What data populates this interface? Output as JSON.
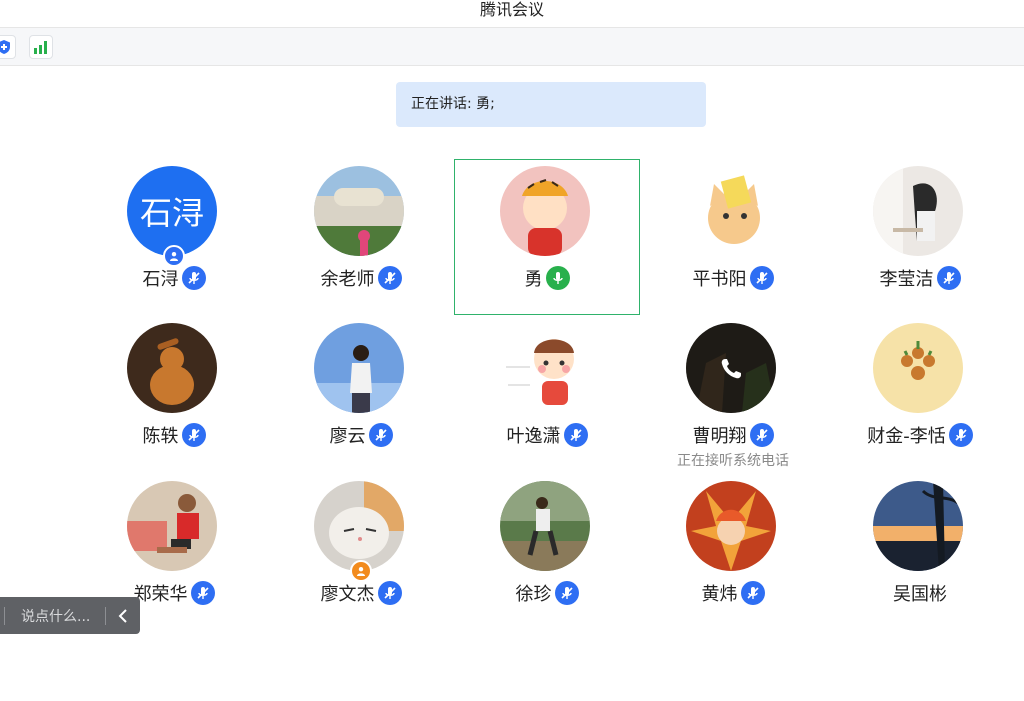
{
  "window": {
    "title": "腾讯会议"
  },
  "toolbar": {
    "security_icon": "shield-plus-icon",
    "network_icon": "signal-bars-icon",
    "accent": "#2e6ef3",
    "signal_color": "#28b04c"
  },
  "speaking_banner": {
    "text": "正在讲话: 勇;"
  },
  "participants": [
    {
      "name": "石浔",
      "avatar_text": "石浔",
      "mic": "muted",
      "badge": "host-user-icon"
    },
    {
      "name": "余老师",
      "mic": "muted"
    },
    {
      "name": "勇",
      "mic": "speaking",
      "active": true
    },
    {
      "name": "平书阳",
      "mic": "muted"
    },
    {
      "name": "李莹洁",
      "mic": "muted"
    },
    {
      "name": "陈轶",
      "mic": "muted"
    },
    {
      "name": "廖云",
      "mic": "muted"
    },
    {
      "name": "叶逸潇",
      "mic": "muted"
    },
    {
      "name": "曹明翔",
      "mic": "muted",
      "status": "正在接听系统电话",
      "overlay_icon": "phone-icon"
    },
    {
      "name": "财金-李恬",
      "mic": "muted"
    },
    {
      "name": "郑荣华",
      "mic": "muted"
    },
    {
      "name": "廖文杰",
      "mic": "muted",
      "badge": "co-host-user-icon"
    },
    {
      "name": "徐珍",
      "mic": "muted"
    },
    {
      "name": "黄炜",
      "mic": "muted"
    },
    {
      "name": "吴国彬",
      "mic": "none"
    }
  ],
  "chat": {
    "placeholder": "说点什么...",
    "collapse_icon": "chevron-left-icon"
  }
}
